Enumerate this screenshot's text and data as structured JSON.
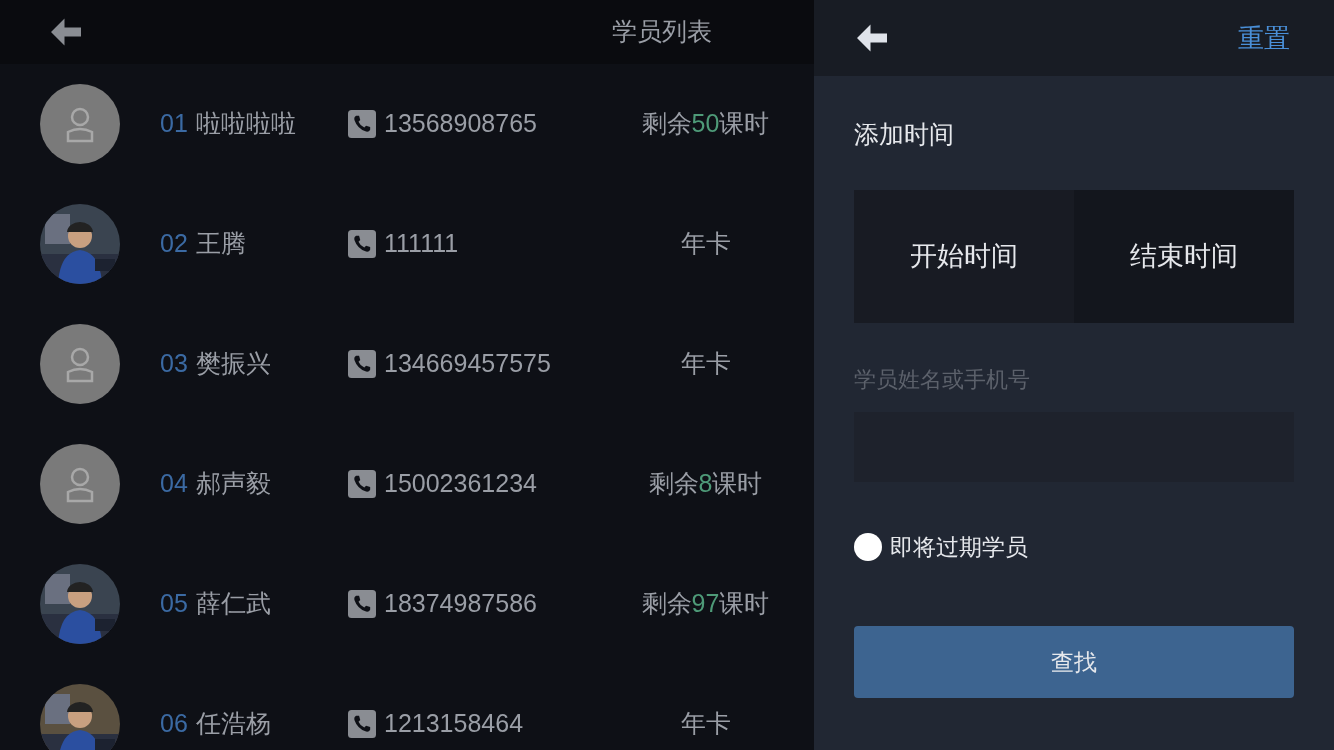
{
  "list_panel": {
    "title": "学员列表"
  },
  "students": [
    {
      "number": "01",
      "name": "啦啦啦啦",
      "phone": "13568908765",
      "avatar": {
        "kind": "placeholder"
      },
      "plan": {
        "kind": "hours",
        "prefix": "剩余",
        "count": "50",
        "suffix": "课时"
      }
    },
    {
      "number": "02",
      "name": "王腾",
      "phone": "111111",
      "plan": {
        "kind": "card",
        "text": "年卡"
      }
    },
    {
      "number": "03",
      "name": "樊振兴",
      "phone": "134669457575",
      "avatar": {
        "kind": "placeholder"
      },
      "plan": {
        "kind": "card",
        "text": "年卡"
      }
    },
    {
      "number": "04",
      "name": "郝声毅",
      "phone": "15002361234",
      "avatar": {
        "kind": "placeholder"
      },
      "plan": {
        "kind": "hours",
        "prefix": "剩余",
        "count": "8",
        "suffix": "课时"
      }
    },
    {
      "number": "05",
      "name": "薛仁武",
      "phone": "18374987586",
      "plan": {
        "kind": "hours",
        "prefix": "剩余",
        "count": "97",
        "suffix": "课时"
      }
    },
    {
      "number": "06",
      "name": "任浩杨",
      "phone": "1213158464",
      "plan": {
        "kind": "card",
        "text": "年卡"
      }
    }
  ],
  "filter_panel": {
    "reset": "重置",
    "section_title": "添加时间",
    "start_time": "开始时间",
    "end_time": "结束时间",
    "search_label": "学员姓名或手机号",
    "expiring": {
      "label": "即将过期学员",
      "checked": false
    },
    "search_button": "查找"
  }
}
